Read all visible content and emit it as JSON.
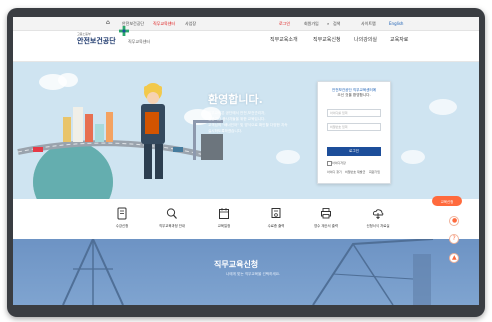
{
  "util_bar": {
    "links": [
      "안전보건공단",
      "직무교육센터",
      "사업장"
    ],
    "right_links": [
      "로그인",
      "회원가입",
      "검색",
      "사이트맵",
      "English"
    ]
  },
  "brand": {
    "small": "고용노동부",
    "name": "안전보건공단",
    "sub": "직무교육센터"
  },
  "menu": [
    "직무교육소개",
    "직무교육신청",
    "나의강의실",
    "교육자료"
  ],
  "hero": {
    "welcome": "환영합니다.",
    "desc": [
      "직무교육은 공단에서 안전,보건관리자,",
      "전문기관 종사자들을 위한 교육입니다.",
      "고객님의 \"배너인어\" 및 방식으로 확인할 다양한 지속",
      "실시하도록하겠습니다."
    ]
  },
  "login": {
    "title": "안전보건공단 직무교육센터에",
    "subtitle": "오신 것을 환영합니다.",
    "id_placeholder": "아이디를 입력",
    "pw_placeholder": "비밀번호 입력",
    "button": "로그인",
    "remember": "아이디저장",
    "links": [
      "아이디 찾기",
      "비밀번호 재발급",
      "회원가입"
    ]
  },
  "quick_menu": [
    "수강신청",
    "직무교육과정 안내",
    "교육일정",
    "수료증 출력",
    "영수 계산서 출력",
    "신청서식 자료실"
  ],
  "banner": {
    "title": "직무교육신청",
    "subtitle": "나에게 맞는 직무교육을 선택하세요."
  },
  "floating": {
    "button": "교육신청"
  },
  "colors": {
    "hero_bg": "#cfe4f1",
    "brand_blue": "#1d4e9a",
    "banner_bg": "#6d93c4",
    "accent_orange": "#ff6a3d"
  }
}
